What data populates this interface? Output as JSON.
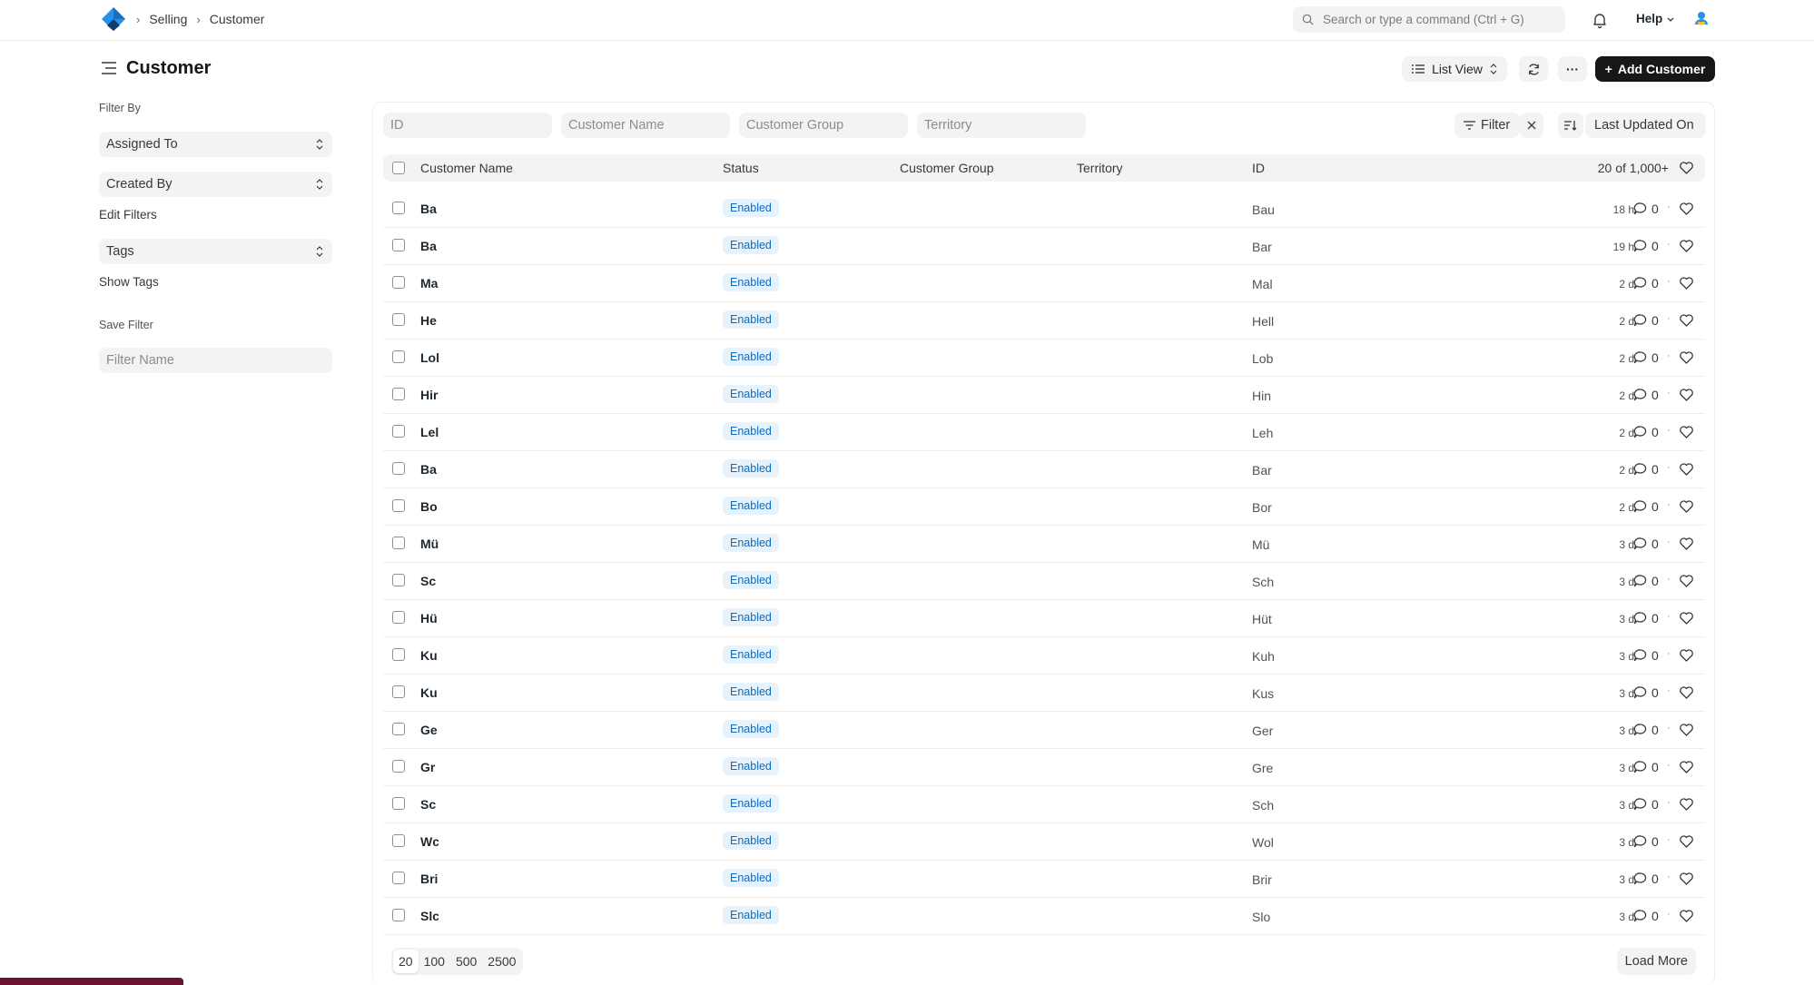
{
  "navbar": {
    "breadcrumbs": [
      "Selling",
      "Customer"
    ],
    "search_placeholder": "Search or type a command (Ctrl + G)",
    "help_label": "Help"
  },
  "page": {
    "title": "Customer",
    "view_label": "List View",
    "more_label": "···",
    "add_label": "Add Customer"
  },
  "sidebar": {
    "filter_by_label": "Filter By",
    "assigned_to": "Assigned To",
    "created_by": "Created By",
    "edit_filters": "Edit Filters",
    "tags": "Tags",
    "show_tags": "Show Tags",
    "save_filter_label": "Save Filter",
    "filter_name_placeholder": "Filter Name"
  },
  "filters": {
    "id_placeholder": "ID",
    "customer_name_placeholder": "Customer Name",
    "customer_group_placeholder": "Customer Group",
    "territory_placeholder": "Territory",
    "filter_label": "Filter",
    "sort_label": "Last Updated On"
  },
  "table": {
    "headers": {
      "customer_name": "Customer Name",
      "status": "Status",
      "customer_group": "Customer Group",
      "territory": "Territory",
      "id": "ID",
      "count": "20 of 1,000+"
    },
    "rows": [
      {
        "name": "Ba",
        "status": "Enabled",
        "id": "Bau",
        "time": "18 h",
        "comments": "0"
      },
      {
        "name": "Ba",
        "status": "Enabled",
        "id": "Bar",
        "time": "19 h",
        "comments": "0"
      },
      {
        "name": "Ma",
        "status": "Enabled",
        "id": "Mal",
        "time": "2 d",
        "comments": "0"
      },
      {
        "name": "He",
        "status": "Enabled",
        "id": "Hell",
        "time": "2 d",
        "comments": "0"
      },
      {
        "name": "Lol",
        "status": "Enabled",
        "id": "Lob",
        "time": "2 d",
        "comments": "0"
      },
      {
        "name": "Hir",
        "status": "Enabled",
        "id": "Hin",
        "time": "2 d",
        "comments": "0"
      },
      {
        "name": "Lel",
        "status": "Enabled",
        "id": "Leh",
        "time": "2 d",
        "comments": "0"
      },
      {
        "name": "Ba",
        "status": "Enabled",
        "id": "Bar",
        "time": "2 d",
        "comments": "0"
      },
      {
        "name": "Bo",
        "status": "Enabled",
        "id": "Bor",
        "time": "2 d",
        "comments": "0"
      },
      {
        "name": "Mü",
        "status": "Enabled",
        "id": "Mü",
        "time": "3 d",
        "comments": "0"
      },
      {
        "name": "Sc",
        "status": "Enabled",
        "id": "Sch",
        "time": "3 d",
        "comments": "0"
      },
      {
        "name": "Hü",
        "status": "Enabled",
        "id": "Hüt",
        "time": "3 d",
        "comments": "0"
      },
      {
        "name": "Ku",
        "status": "Enabled",
        "id": "Kuh",
        "time": "3 d",
        "comments": "0"
      },
      {
        "name": "Ku",
        "status": "Enabled",
        "id": "Kus",
        "time": "3 d",
        "comments": "0"
      },
      {
        "name": "Ge",
        "status": "Enabled",
        "id": "Ger",
        "time": "3 d",
        "comments": "0"
      },
      {
        "name": "Gr",
        "status": "Enabled",
        "id": "Gre",
        "time": "3 d",
        "comments": "0"
      },
      {
        "name": "Sc",
        "status": "Enabled",
        "id": "Sch",
        "time": "3 d",
        "comments": "0"
      },
      {
        "name": "Wc",
        "status": "Enabled",
        "id": "Wol",
        "time": "3 d",
        "comments": "0"
      },
      {
        "name": "Bri",
        "status": "Enabled",
        "id": "Brir",
        "time": "3 d",
        "comments": "0"
      },
      {
        "name": "Slc",
        "status": "Enabled",
        "id": "Slo",
        "time": "3 d",
        "comments": "0"
      }
    ]
  },
  "pager": {
    "sizes": [
      "20",
      "100",
      "500",
      "2500"
    ],
    "load_more": "Load More"
  },
  "colors": {
    "primary": "#171717",
    "status_bg": "#e6f2fc",
    "status_text": "#0b6cc1"
  }
}
